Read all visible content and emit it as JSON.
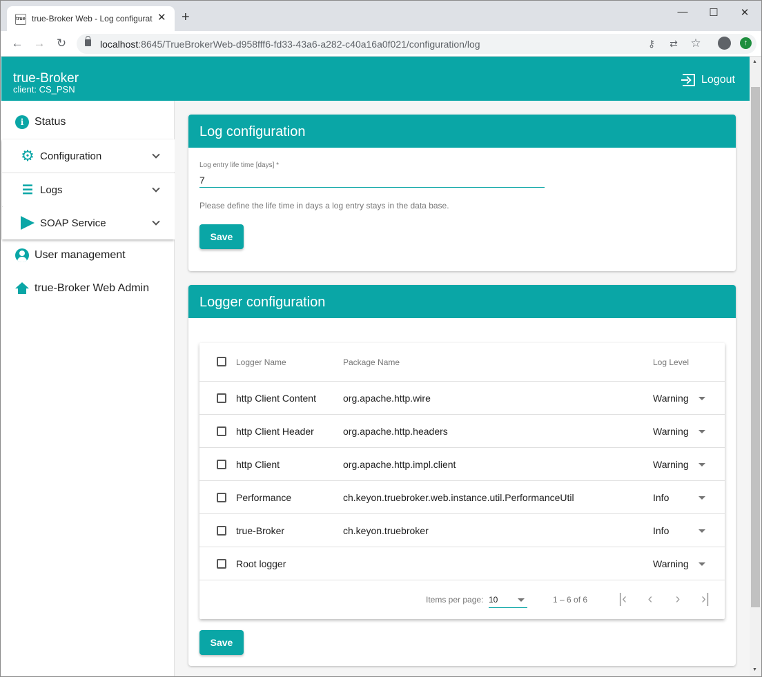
{
  "browser": {
    "tab_title": "true-Broker Web - Log configurat",
    "favicon_text": "true",
    "close_glyph": "✕",
    "new_tab_glyph": "+",
    "minimize_glyph": "—",
    "maximize_glyph": "☐",
    "close_window_glyph": "✕",
    "back_glyph": "←",
    "forward_glyph": "→",
    "reload_glyph": "↻",
    "url_host": "localhost",
    "url_rest": ":8645/TrueBrokerWeb-d958fff6-fd33-43a6-a282-c40a16a0f021/configuration/log",
    "key_glyph": "⚷",
    "translate_glyph": "⇄",
    "star_glyph": "☆",
    "update_glyph": "↑"
  },
  "header": {
    "brand": "true-Broker",
    "client": "client: CS_PSN",
    "logout_label": "Logout"
  },
  "sidebar": {
    "status": "Status",
    "configuration": "Configuration",
    "logs": "Logs",
    "soap_service": "SOAP Service",
    "user_management": "User management",
    "web_admin": "true-Broker Web Admin",
    "gear_glyph": "⚙",
    "list_glyph": "☰",
    "info_glyph": "i"
  },
  "log_config": {
    "title": "Log configuration",
    "field_label": "Log entry life time [days] *",
    "field_value": "7",
    "hint": "Please define the life time in days a log entry stays in the data base.",
    "save_label": "Save"
  },
  "logger_config": {
    "title": "Logger configuration",
    "columns": {
      "name": "Logger Name",
      "package": "Package Name",
      "level": "Log Level"
    },
    "rows": [
      {
        "name": "http Client Content",
        "package": "org.apache.http.wire",
        "level": "Warning"
      },
      {
        "name": "http Client Header",
        "package": "org.apache.http.headers",
        "level": "Warning"
      },
      {
        "name": "http Client",
        "package": "org.apache.http.impl.client",
        "level": "Warning"
      },
      {
        "name": "Performance",
        "package": "ch.keyon.truebroker.web.instance.util.PerformanceUtil",
        "level": "Info"
      },
      {
        "name": "true-Broker",
        "package": "ch.keyon.truebroker",
        "level": "Info"
      },
      {
        "name": "Root logger",
        "package": "",
        "level": "Warning"
      }
    ],
    "paginator": {
      "items_per_page_label": "Items per page:",
      "items_per_page_value": "10",
      "range": "1 – 6 of 6",
      "first_glyph": "|‹",
      "prev_glyph": "‹",
      "next_glyph": "›",
      "last_glyph": "›|"
    },
    "save_label": "Save"
  },
  "colors": {
    "accent": "#0aa6a6"
  }
}
